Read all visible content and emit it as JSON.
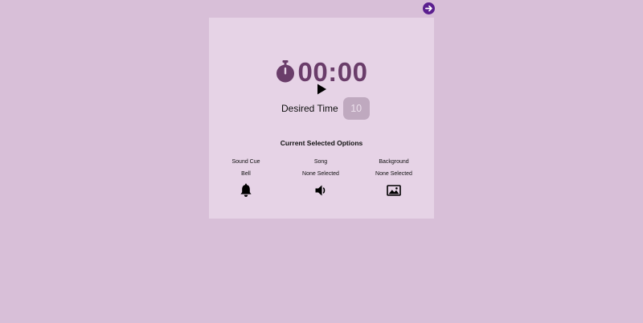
{
  "timer": {
    "display": "00:00",
    "icon": "stopwatch-icon"
  },
  "controls": {
    "play_icon": "play-icon",
    "next_icon": "arrow-right-icon"
  },
  "desired_time": {
    "label": "Desired Time",
    "value": "10"
  },
  "options": {
    "title": "Current Selected Options",
    "items": [
      {
        "name": "Sound Cue",
        "value": "Bell",
        "icon": "bell-icon"
      },
      {
        "name": "Song",
        "value": "None Selected",
        "icon": "speaker-icon"
      },
      {
        "name": "Background",
        "value": "None Selected",
        "icon": "image-icon"
      }
    ]
  },
  "colors": {
    "page_bg": "#d8bfd8",
    "card_bg": "#e6d3e6",
    "timer_text": "#6a3d6a",
    "accent": "#5b1f8f",
    "input_bg": "#bfa9bf"
  }
}
